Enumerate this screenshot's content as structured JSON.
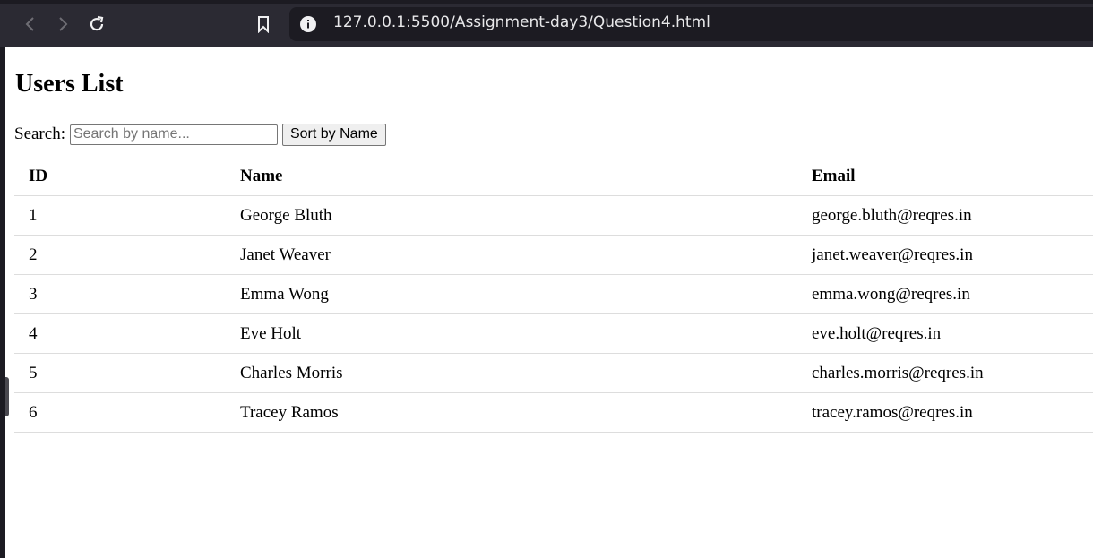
{
  "browser": {
    "url": "127.0.0.1:5500/Assignment-day3/Question4.html",
    "icons": [
      "back-icon",
      "forward-icon",
      "reload-icon",
      "bookmark-icon",
      "info-icon"
    ]
  },
  "page": {
    "title": "Users List",
    "search_label": "Search:",
    "search_placeholder": "Search by name...",
    "search_value": "",
    "sort_button": "Sort by Name"
  },
  "table": {
    "headers": [
      "ID",
      "Name",
      "Email"
    ],
    "rows": [
      [
        "1",
        "George Bluth",
        "george.bluth@reqres.in"
      ],
      [
        "2",
        "Janet Weaver",
        "janet.weaver@reqres.in"
      ],
      [
        "3",
        "Emma Wong",
        "emma.wong@reqres.in"
      ],
      [
        "4",
        "Eve Holt",
        "eve.holt@reqres.in"
      ],
      [
        "5",
        "Charles Morris",
        "charles.morris@reqres.in"
      ],
      [
        "6",
        "Tracey Ramos",
        "tracey.ramos@reqres.in"
      ]
    ]
  }
}
